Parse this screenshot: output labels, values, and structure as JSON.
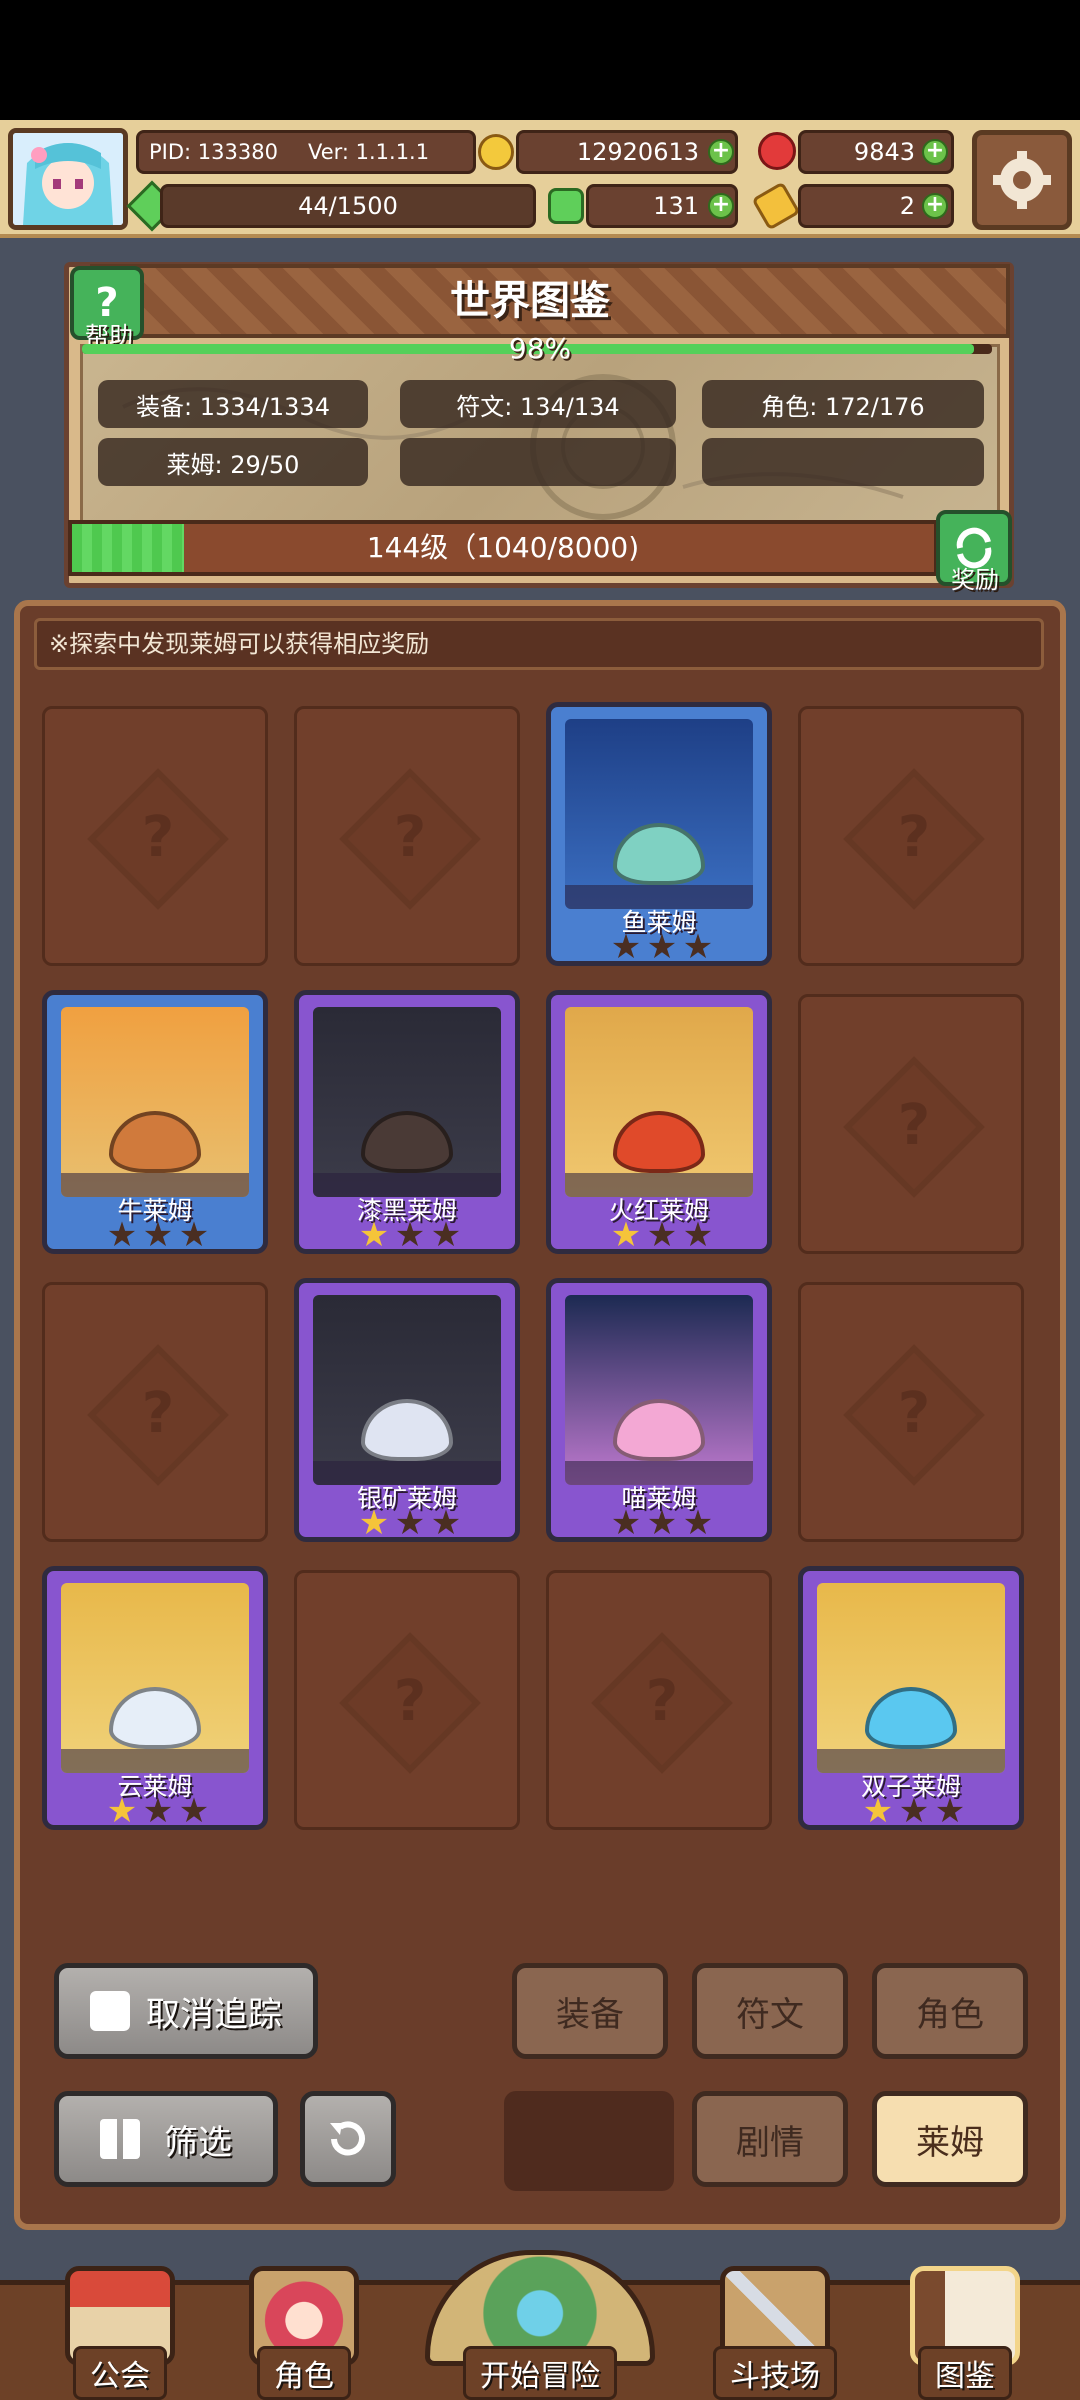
{
  "header": {
    "pid": "PID: 133380",
    "version": "Ver: 1.1.1.1",
    "gold": "12920613",
    "gems": "9843",
    "energy": "44/1500",
    "clover": "131",
    "key": "2"
  },
  "book": {
    "help_label": "帮助",
    "title": "世界图鉴",
    "progress_percent_label": "98%",
    "progress_percent": 98,
    "stats": {
      "equipment": "装备: 1334/1334",
      "runes": "符文: 134/134",
      "characters": "角色: 172/176",
      "slimes": "莱姆: 29/50"
    },
    "level_text": "144级（1040/8000)",
    "level_progress": 0.13,
    "reward_label": "奖励"
  },
  "notice": "※探索中发现莱姆可以获得相应奖励",
  "grid": {
    "slots": [
      {
        "found": false
      },
      {
        "found": false
      },
      {
        "found": true,
        "name": "鱼莱姆",
        "frame": "blue",
        "stars": 0
      },
      {
        "found": false
      },
      {
        "found": true,
        "name": "牛莱姆",
        "frame": "blue",
        "stars": 0
      },
      {
        "found": true,
        "name": "漆黑莱姆",
        "frame": "purple",
        "stars": 1
      },
      {
        "found": true,
        "name": "火红莱姆",
        "frame": "purple",
        "stars": 1
      },
      {
        "found": false
      },
      {
        "found": false
      },
      {
        "found": true,
        "name": "银矿莱姆",
        "frame": "purple",
        "stars": 1
      },
      {
        "found": true,
        "name": "喵莱姆",
        "frame": "purple",
        "stars": 0
      },
      {
        "found": false
      },
      {
        "found": true,
        "name": "云莱姆",
        "frame": "purple",
        "stars": 1
      },
      {
        "found": false
      },
      {
        "found": false
      },
      {
        "found": true,
        "name": "双子莱姆",
        "frame": "purple",
        "stars": 1
      }
    ],
    "unknown_mark": "?"
  },
  "controls": {
    "untrack": "取消追踪",
    "filter": "筛选",
    "tab_equipment": "装备",
    "tab_runes": "符文",
    "tab_characters": "角色",
    "tab_story": "剧情",
    "tab_slimes": "莱姆"
  },
  "nav": {
    "guild": "公会",
    "character": "角色",
    "adventure": "开始冒险",
    "arena": "斗技场",
    "codex": "图鉴"
  },
  "colors": {
    "panel": "#6a3d2a",
    "blue_frame": "#4a7fd0",
    "purple_frame": "#8855cf",
    "star_on": "#f5c43a",
    "progress_green": "#4fc94f"
  }
}
